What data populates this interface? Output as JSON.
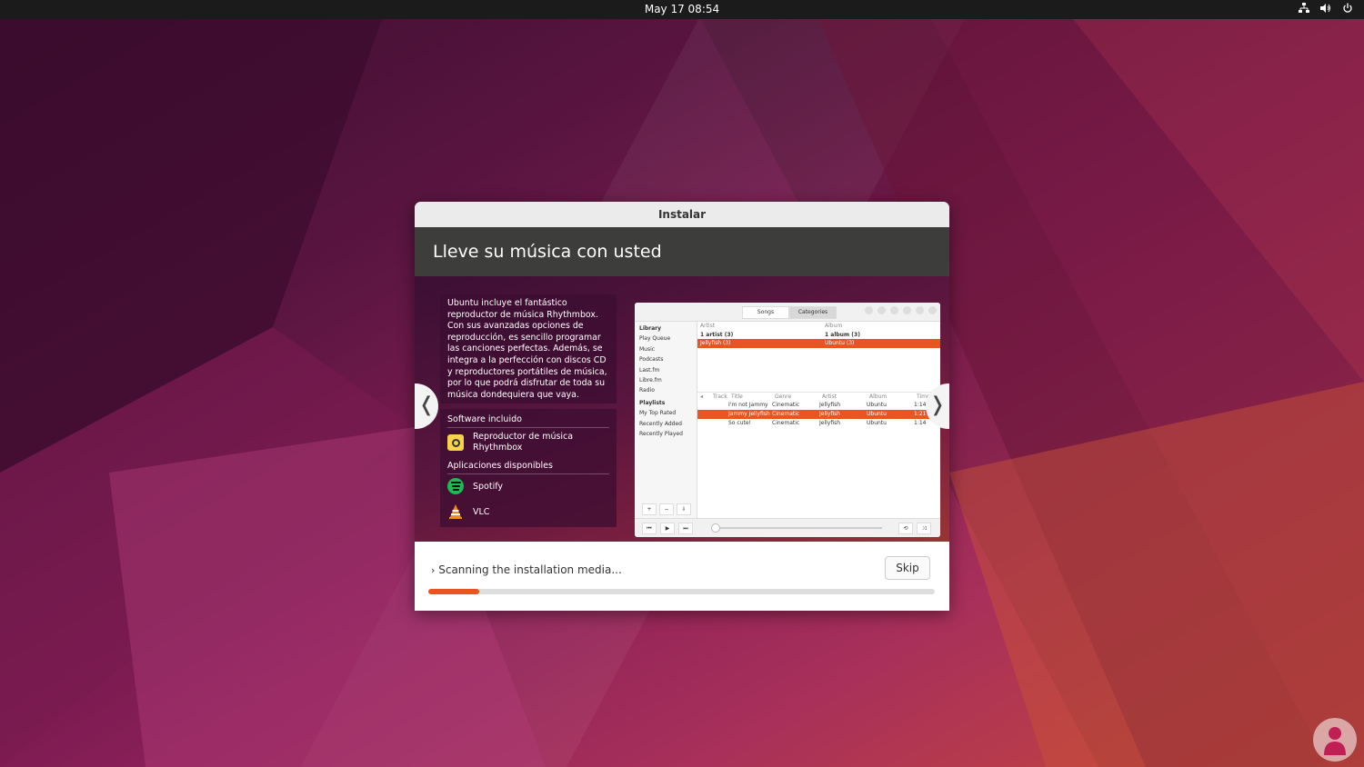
{
  "topbar": {
    "datetime": "May 17  08:54",
    "tray_icons": [
      "network-icon",
      "volume-icon",
      "power-icon"
    ]
  },
  "dialog": {
    "title": "Instalar",
    "slide_title": "Lleve su música con usted",
    "description": "Ubuntu incluye el fantástico reproductor de música Rhythmbox. Con sus avanzadas opciones de reproducción, es sencillo programar las canciones perfectas. Además, se integra a la perfección con discos CD y reproductores portátiles de música, por lo que podrá disfrutar de toda su música dondequiera que vaya.",
    "included_title": "Software incluido",
    "included_apps": [
      {
        "name": "Reproductor de música Rhythmbox",
        "icon": "rhythmbox-icon"
      }
    ],
    "available_title": "Aplicaciones disponibles",
    "available_apps": [
      {
        "name": "Spotify",
        "icon": "spotify-icon"
      },
      {
        "name": "VLC",
        "icon": "vlc-icon"
      }
    ],
    "prev_arrow": "❬",
    "next_arrow": "❭",
    "progress_text": "Scanning the installation media...",
    "progress_fraction": 0.1,
    "skip_label": "Skip"
  },
  "rhythmbox": {
    "tabs": [
      "Songs",
      "Categories"
    ],
    "library_title": "Library",
    "library_items": [
      "Play Queue",
      "Music",
      "Podcasts",
      "Last.fm",
      "Libre.fm",
      "Radio"
    ],
    "playlists_title": "Playlists",
    "playlist_items": [
      "My Top Rated",
      "Recently Added",
      "Recently Played"
    ],
    "browser_headers": [
      "Artist",
      "Album"
    ],
    "browser_rows": [
      {
        "artist": "1 artist (3)",
        "album": "1 album (3)",
        "selected": false
      },
      {
        "artist": "Jellyfish (3)",
        "album": "Ubuntu (3)",
        "selected": true
      }
    ],
    "track_headers": [
      "Track",
      "Title",
      "Genre",
      "Artist",
      "Album",
      "Time"
    ],
    "tracks": [
      {
        "track": "",
        "title": "I'm not Jammy",
        "genre": "Cinematic",
        "artist": "Jellyfish",
        "album": "Ubuntu",
        "time": "1:14",
        "selected": false
      },
      {
        "track": "",
        "title": "Jammy Jellyfish",
        "genre": "Cinematic",
        "artist": "Jellyfish",
        "album": "Ubuntu",
        "time": "1:21",
        "selected": true
      },
      {
        "track": "",
        "title": "So cute!",
        "genre": "Cinematic",
        "artist": "Jellyfish",
        "album": "Ubuntu",
        "time": "1:14",
        "selected": false
      }
    ],
    "side_buttons": [
      "+",
      "−",
      "⇩"
    ],
    "transport_buttons": [
      "⏮",
      "▶",
      "⏭"
    ],
    "accent": "#e95420"
  },
  "colors": {
    "accent": "#e95420",
    "header_bg": "#3d3d3b"
  }
}
